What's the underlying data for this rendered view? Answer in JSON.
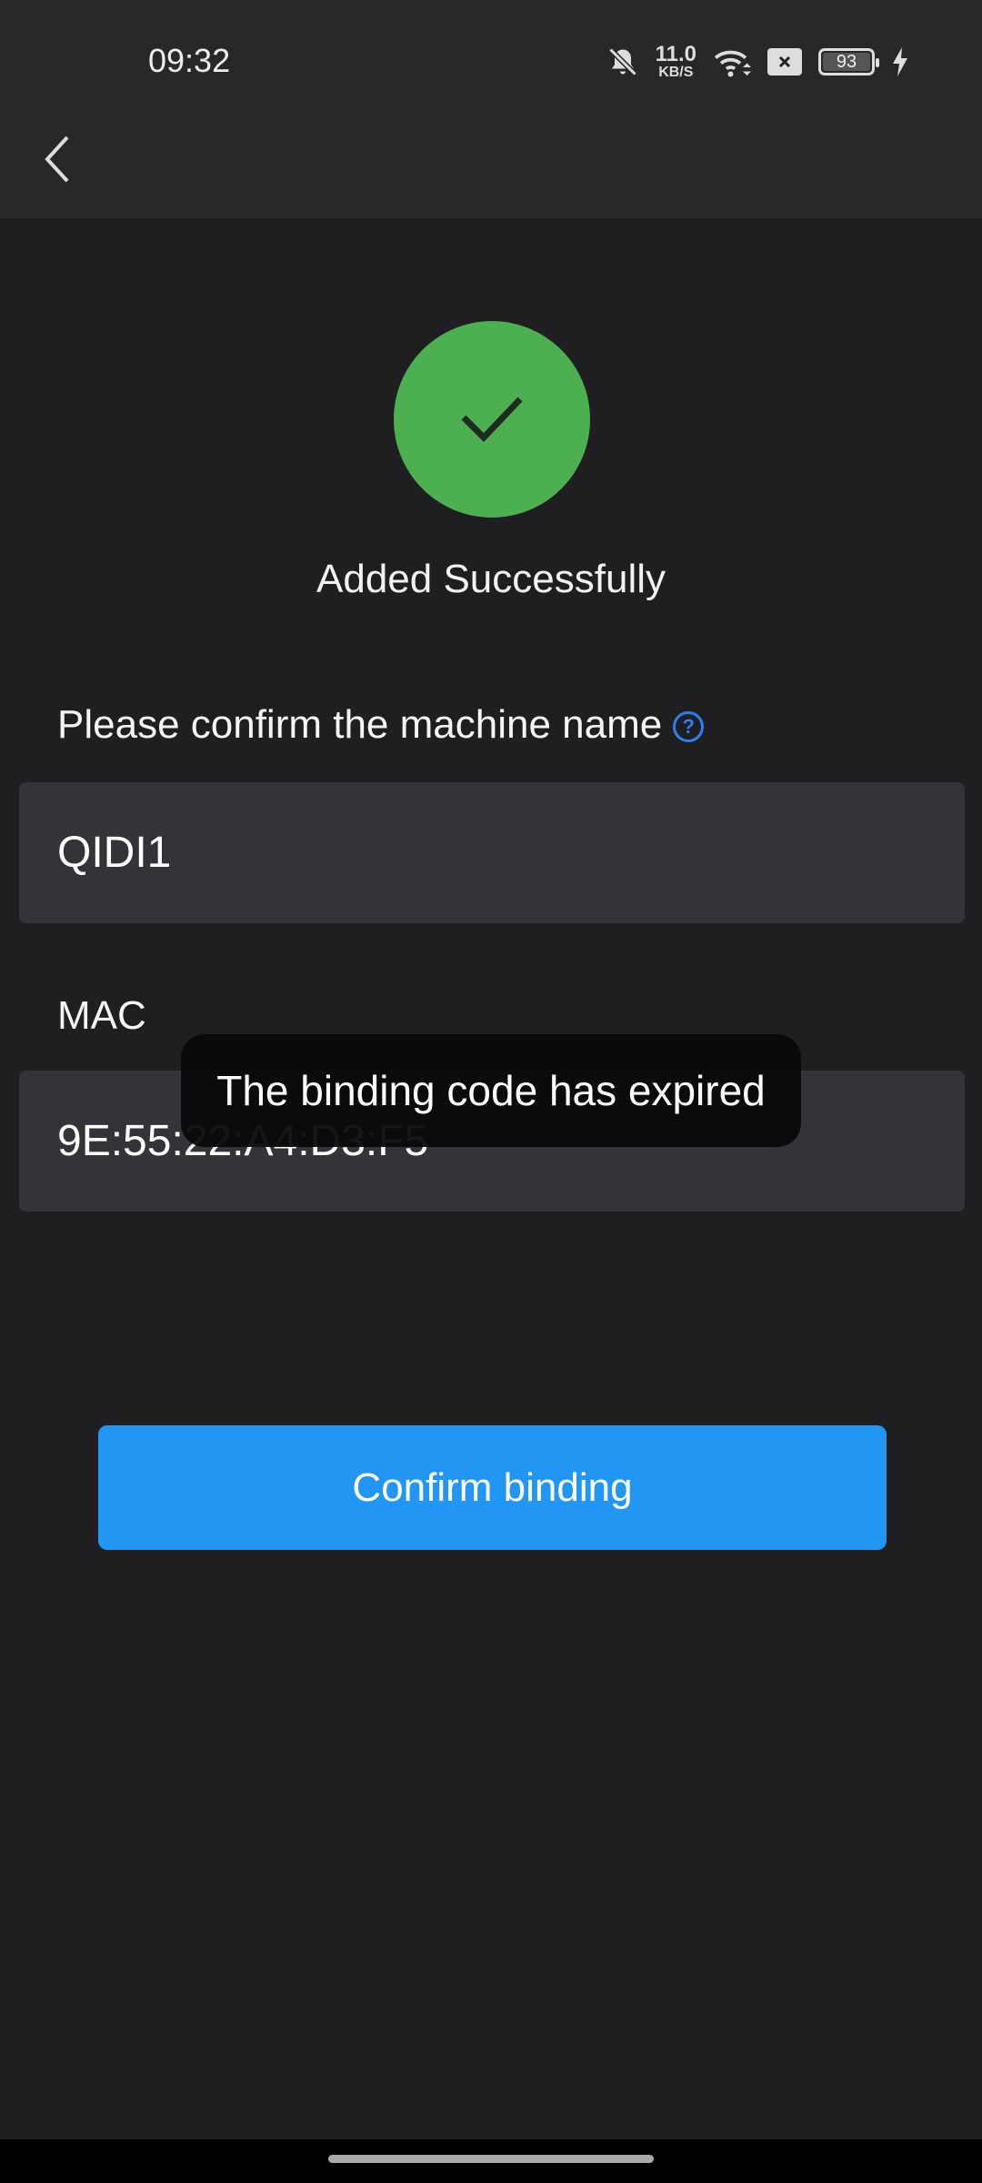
{
  "status_bar": {
    "time": "09:32",
    "speed_value": "11.0",
    "speed_unit": "KB/S",
    "battery": "93",
    "icons": [
      "bell-off-icon",
      "wifi-icon",
      "sim-x-icon",
      "battery-icon",
      "charging-icon"
    ]
  },
  "header": {
    "back_icon": "chevron-left-icon"
  },
  "success": {
    "icon": "check-icon",
    "text": "Added Successfully",
    "color": "#4caf50"
  },
  "form": {
    "name_label": "Please confirm the machine name",
    "help_icon": "?",
    "name_value": "QIDI1",
    "mac_label": "MAC",
    "mac_value": "9E:55:22:A4:D3:F5"
  },
  "toast": "The binding code has expired",
  "confirm_button": {
    "label": "Confirm binding",
    "color": "#2196f3"
  }
}
